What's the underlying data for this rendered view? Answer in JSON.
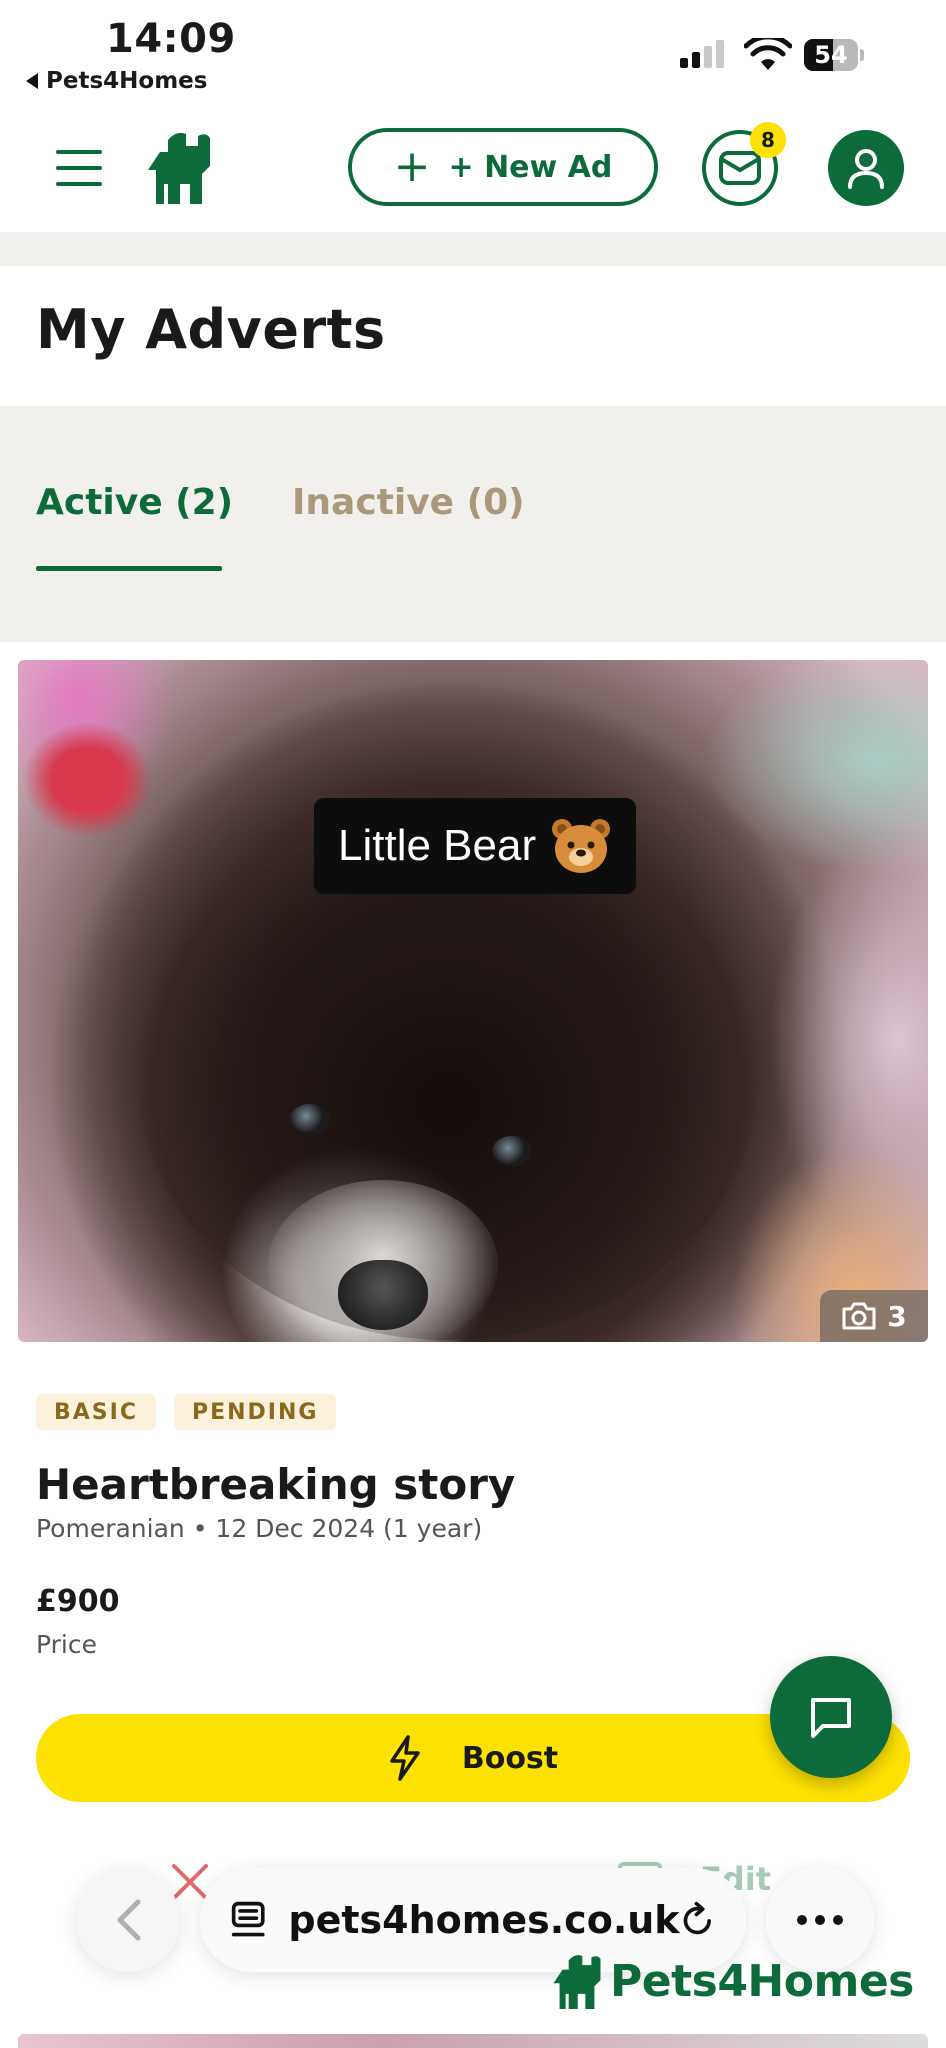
{
  "status_bar": {
    "time": "14:09",
    "back_app": "Pets4Homes",
    "battery": "54",
    "battery_level": 0.54
  },
  "header": {
    "new_ad_label": "+ New Ad",
    "messages_count": "8",
    "brand_color": "#0d6b3b"
  },
  "page": {
    "title": "My Adverts"
  },
  "tabs": [
    {
      "label": "Active (2)",
      "active": true
    },
    {
      "label": "Inactive (0)",
      "active": false
    }
  ],
  "advert": {
    "photo_caption": "Little Bear",
    "photo_count": "3",
    "badges": [
      "BASIC",
      "PENDING"
    ],
    "title": "Heartbreaking story",
    "meta": "Pomeranian • 12 Dec 2024 (1 year)",
    "price": "£900",
    "price_label": "Price",
    "boost_label": "Boost",
    "edit_label": "Edit"
  },
  "browser": {
    "url": "pets4homes.co.uk"
  },
  "footer": {
    "brand": "Pets4Homes"
  },
  "colors": {
    "accent_green": "#0d6b3b",
    "boost_yellow": "#fde100",
    "tab_band": "#f2f0ec",
    "inactive_tab": "#a9997a"
  },
  "icons": [
    "menu-icon",
    "logo-icon",
    "plus-icon",
    "mail-icon",
    "user-icon",
    "camera-icon",
    "bolt-icon",
    "chat-icon",
    "close-icon",
    "edit-icon",
    "chevron-left-icon",
    "reader-icon",
    "reload-icon",
    "more-icon"
  ]
}
